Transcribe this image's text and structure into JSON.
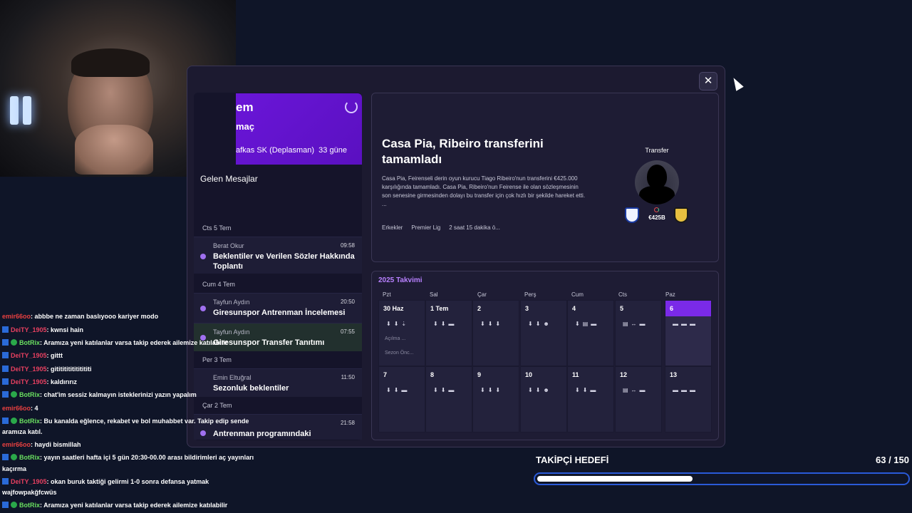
{
  "colors": {
    "accent": "#7a2ae8",
    "bg": "#0f1528"
  },
  "next_match": {
    "title": "em",
    "subtitle": "maç",
    "opponent": "afkas SK (Deplasman)",
    "when": "33 güne"
  },
  "inbox": {
    "title": "Gelen Mesajlar",
    "groups": [
      {
        "day": "Cts 5 Tem"
      },
      {
        "day": "Cum 4 Tem"
      },
      {
        "day": "Per 3 Tem"
      },
      {
        "day": "Çar 2 Tem"
      }
    ],
    "messages": [
      {
        "sender": "Berat Okur",
        "time": "09:58",
        "subject": "Beklentiler ve Verilen Sözler Hakkında Toplantı"
      },
      {
        "sender": "Tayfun Aydın",
        "time": "20:50",
        "subject": "Giresunspor Antrenman İncelemesi"
      },
      {
        "sender": "Tayfun Aydın",
        "time": "07:55",
        "subject": "Giresunspor Transfer Tanıtımı"
      },
      {
        "sender": "Emin Eltuğral",
        "time": "11:50",
        "subject": "Sezonluk beklentiler"
      },
      {
        "sender": "",
        "time": "21:58",
        "subject": "Antrenman programındaki"
      }
    ]
  },
  "news": {
    "title": "Casa Pia, Ribeiro transferini tamamladı",
    "body": "Casa Pia, Feirenseli derin oyun kurucu Tiago Ribeiro'nun transferini €425.000 karşılığında tamamladı. Casa Pia, Ribeiro'nun Feirense ile olan sözleşmesinin son senesine girmesinden dolayı bu transfer için çok hızlı bir şekilde hareket etti.",
    "ellipsis": "...",
    "tags": [
      "Erkekler",
      "Premier Lig",
      "2 saat 15 dakika ö..."
    ],
    "category": "Transfer",
    "fee": "€425B"
  },
  "calendar": {
    "title": "2025 Takvimi",
    "days": [
      "Pzt",
      "Sal",
      "Çar",
      "Perş",
      "Cum",
      "Cts",
      "Paz"
    ],
    "week1": [
      {
        "num": "30 Haz",
        "icons": "⬇⬇⇣",
        "ev1": "Açılma ...",
        "ev2": "Sezon Önc..."
      },
      {
        "num": "1 Tem",
        "icons": "⬇⬇▬"
      },
      {
        "num": "2",
        "icons": "⬇⬇⬇"
      },
      {
        "num": "3",
        "icons": "⬇⬇☻"
      },
      {
        "num": "4",
        "icons": "⬇▤▬"
      },
      {
        "num": "5",
        "icons": "▤↔▬"
      },
      {
        "num": "6",
        "icons": "▬▬▬"
      }
    ],
    "week2": [
      {
        "num": "7",
        "icons": "⬇⬇▬"
      },
      {
        "num": "8",
        "icons": "⬇⬇▬"
      },
      {
        "num": "9",
        "icons": "⬇⬇⬇"
      },
      {
        "num": "10",
        "icons": "⬇⬇☻"
      },
      {
        "num": "11",
        "icons": "⬇⬇▬"
      },
      {
        "num": "12",
        "icons": "▤↔▬"
      },
      {
        "num": "13",
        "icons": "▬▬▬"
      }
    ]
  },
  "chat": [
    {
      "user": "emir66oo",
      "text": ": abbbe ne zaman baslıyooo kariyer modo"
    },
    {
      "user": "DeiTY_1905",
      "text": ": kwnsi hain"
    },
    {
      "user": "BotRix",
      "text": ": Aramıza yeni katılanlar varsa takip ederek ailemize katılabilir"
    },
    {
      "user": "DeiTY_1905",
      "text": ": gittt"
    },
    {
      "user": "DeiTY_1905",
      "text": ": gitititititititititi"
    },
    {
      "user": "DeiTY_1905",
      "text": ": kaldırırız"
    },
    {
      "user": "BotRix",
      "text": ": chat'im sessiz kalmayın isteklerinizi yazın yapalım"
    },
    {
      "user": "emir66oo",
      "text": ": 4"
    },
    {
      "user": "BotRix",
      "text": ": Bu kanalda eğlence, rekabet ve bol muhabbet var. Takip edip sende"
    },
    {
      "user": "",
      "text": "aramıza katıl."
    },
    {
      "user": "emir66oo",
      "text": ": haydi bismillah"
    },
    {
      "user": "BotRix",
      "text": ": yayın saatleri hafta içi 5 gün 20:30-00.00 arası bildirimleri aç yayınları"
    },
    {
      "user": "",
      "text": "kaçırma"
    },
    {
      "user": "DeiTY_1905",
      "text": ": okan buruk taktiği gelirmi 1-0 sonra defansa yatmak"
    },
    {
      "user": "",
      "text": "wajfowpakğfcwüs"
    },
    {
      "user": "BotRix",
      "text": ": Aramıza yeni katılanlar varsa takip ederek ailemize katılabilir"
    }
  ],
  "goal": {
    "label": "TAKİPÇİ HEDEFİ",
    "count": "63 / 150",
    "progress": 0.42
  }
}
